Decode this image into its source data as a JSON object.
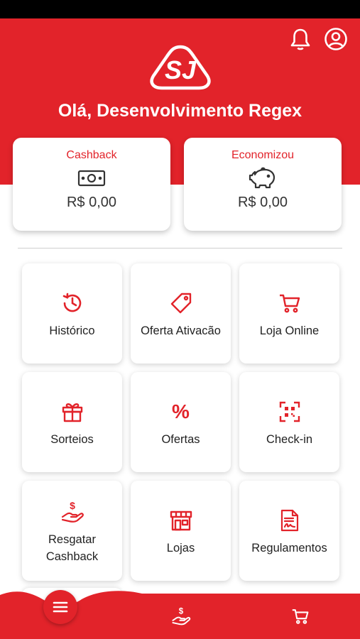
{
  "header": {
    "greeting": "Olá, Desenvolvimento Regex",
    "logo_text": "SJ",
    "icons": [
      "bell-icon",
      "user-account-icon"
    ]
  },
  "summary": {
    "cashback": {
      "label": "Cashback",
      "value": "R$ 0,00",
      "icon": "money-bill-icon"
    },
    "savings": {
      "label": "Economizou",
      "value": "R$ 0,00",
      "icon": "piggy-bank-icon"
    }
  },
  "menu_tiles": [
    {
      "label": "Histórico",
      "icon": "history-clock-icon"
    },
    {
      "label": "Oferta Ativacão",
      "icon": "tag-icon"
    },
    {
      "label": "Loja Online",
      "icon": "shopping-cart-icon"
    },
    {
      "label": "Sorteios",
      "icon": "gift-icon"
    },
    {
      "label": "Ofertas",
      "icon": "percent-icon",
      "glyph": "%"
    },
    {
      "label": "Check-in",
      "icon": "qr-code-icon"
    },
    {
      "label_line1": "Resgatar",
      "label_line2": "Cashback",
      "icon": "hand-money-icon"
    },
    {
      "label": "Lojas",
      "icon": "storefront-icon"
    },
    {
      "label": "Regulamentos",
      "icon": "document-signature-icon"
    }
  ],
  "bottom_nav": {
    "items": [
      "menu-icon",
      "hand-money-icon",
      "shopping-cart-icon"
    ]
  },
  "colors": {
    "brand_red": "#e2232a",
    "text_dark": "#222222",
    "card_bg": "#ffffff"
  }
}
